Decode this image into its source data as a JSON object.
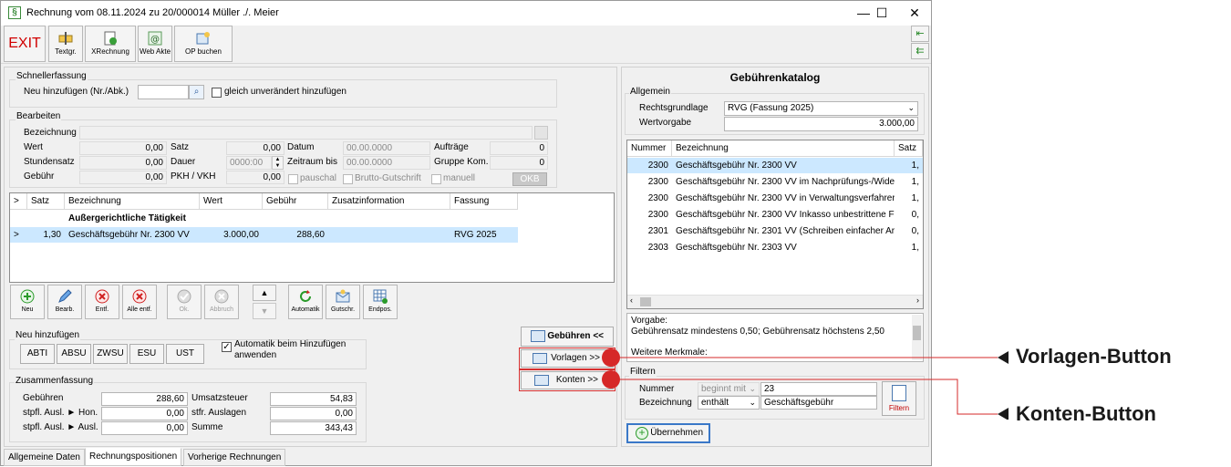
{
  "window": {
    "title": "Rechnung vom 08.11.2024 zu 20/000014  Müller ./. Meier",
    "minimize": "—",
    "maximize": "☐",
    "close": "✕"
  },
  "toolbar": {
    "exit": "EXIT",
    "textgr": "Textgr.",
    "xrechnung": "XRechnung",
    "webakte": "Web Akte",
    "op_buchen": "OP buchen"
  },
  "schnellerfassung": {
    "legend": "Schnellerfassung",
    "neu_label": "Neu hinzufügen (Nr./Abk.)",
    "neu_value": "",
    "gleich_label": "gleich unverändert hinzufügen"
  },
  "bearbeiten": {
    "legend": "Bearbeiten",
    "bezeichnung_label": "Bezeichnung",
    "bezeichnung_value": "",
    "wert_label": "Wert",
    "wert": "0,00",
    "stundensatz_label": "Stundensatz",
    "stundensatz": "0,00",
    "gebuehr_label": "Gebühr",
    "gebuehr": "0,00",
    "satz_label": "Satz",
    "satz": "0,00",
    "dauer_label": "Dauer",
    "dauer": "0000:00",
    "pkh_label": "PKH / VKH",
    "pkh": "0,00",
    "datum_label": "Datum",
    "datum": "00.00.0000",
    "zeitraum_label": "Zeitraum bis",
    "zeitraum": "00.00.0000",
    "auftraege_label": "Aufträge",
    "auftraege": "0",
    "gruppe_label": "Gruppe Kom.",
    "gruppe": "0",
    "pauschal": "pauschal",
    "brutto": "Brutto-Gutschrift",
    "manuell": "manuell",
    "okb": "OKB"
  },
  "positions": {
    "headers": [
      ">",
      "Satz",
      "Bezeichnung",
      "Wert",
      "Gebühr",
      "Zusatzinformation",
      "Fassung"
    ],
    "section": "Außergerichtliche Tätigkeit",
    "row": {
      "marker": ">",
      "satz": "1,30",
      "bezeichnung": "Geschäftsgebühr Nr. 2300 VV",
      "wert": "3.000,00",
      "gebuehr": "288,60",
      "zusatz": "",
      "fassung": "RVG 2025"
    }
  },
  "actions": {
    "neu": "Neu",
    "bearb": "Bearb.",
    "entf": "Entf.",
    "alle_entf": "Alle entf.",
    "ok": "Ok.",
    "abbruch": "Abbruch",
    "automatik": "Automatik",
    "gutschr": "Gutschr.",
    "endpos": "Endpos."
  },
  "neu_hinzufuegen": {
    "legend": "Neu hinzufügen",
    "buttons": [
      "ABTI",
      "ABSU",
      "ZWSU",
      "ESU",
      "UST"
    ],
    "automatik_line1": "Automatik beim Hinzufügen",
    "automatik_line2": "anwenden"
  },
  "side_buttons": {
    "gebuehren": "Gebühren <<",
    "vorlagen": "Vorlagen >>",
    "konten": "Konten >>"
  },
  "zusammenfassung": {
    "legend": "Zusammenfassung",
    "gebuehren_label": "Gebühren",
    "gebuehren": "288,60",
    "stpfl_hon_label": "stpfl. Ausl. ► Hon.",
    "stpfl_hon": "0,00",
    "stpfl_ausl_label": "stpfl. Ausl. ► Ausl.",
    "stpfl_ausl": "0,00",
    "ust_label": "Umsatzsteuer",
    "ust": "54,83",
    "stfr_label": "stfr. Auslagen",
    "stfr": "0,00",
    "summe_label": "Summe",
    "summe": "343,43"
  },
  "tabs": [
    "Allgemeine Daten",
    "Rechnungspositionen",
    "Vorherige Rechnungen"
  ],
  "katalog": {
    "title": "Gebührenkatalog",
    "allgemein": "Allgemein",
    "rechtsgrundlage_label": "Rechtsgrundlage",
    "rechtsgrundlage": "RVG (Fassung 2025)",
    "wertvorgabe_label": "Wertvorgabe",
    "wertvorgabe": "3.000,00",
    "headers": [
      "Nummer",
      "Bezeichnung",
      "Satz"
    ],
    "rows": [
      {
        "nr": "2300",
        "bez": "Geschäftsgebühr Nr. 2300 VV",
        "satz": "1,"
      },
      {
        "nr": "2300",
        "bez": "Geschäftsgebühr Nr. 2300 VV im Nachprüfungs-/Wide",
        "satz": "1,"
      },
      {
        "nr": "2300",
        "bez": "Geschäftsgebühr Nr. 2300 VV in Verwaltungsverfahrer",
        "satz": "1,"
      },
      {
        "nr": "2300",
        "bez": "Geschäftsgebühr Nr. 2300 VV Inkasso unbestrittene F",
        "satz": "0,"
      },
      {
        "nr": "2301",
        "bez": "Geschäftsgebühr Nr. 2301 VV (Schreiben einfacher Ar",
        "satz": "0,"
      },
      {
        "nr": "2303",
        "bez": "Geschäftsgebühr Nr. 2303 VV",
        "satz": "1,"
      }
    ],
    "vorgabe_line1": "Vorgabe:",
    "vorgabe_line2": "Gebührensatz mindestens 0,50; Gebührensatz höchstens 2,50",
    "merkmale": "Weitere Merkmale:",
    "filtern_legend": "Filtern",
    "nummer_label": "Nummer",
    "nummer_op": "beginnt mit",
    "nummer_value": "23",
    "bez_label": "Bezeichnung",
    "bez_op": "enthält",
    "bez_value": "Geschäftsgebühr",
    "filtern_button": "Filtern",
    "uebernehmen": "Übernehmen"
  },
  "callouts": {
    "vorlagen": "Vorlagen-Button",
    "konten": "Konten-Button"
  }
}
